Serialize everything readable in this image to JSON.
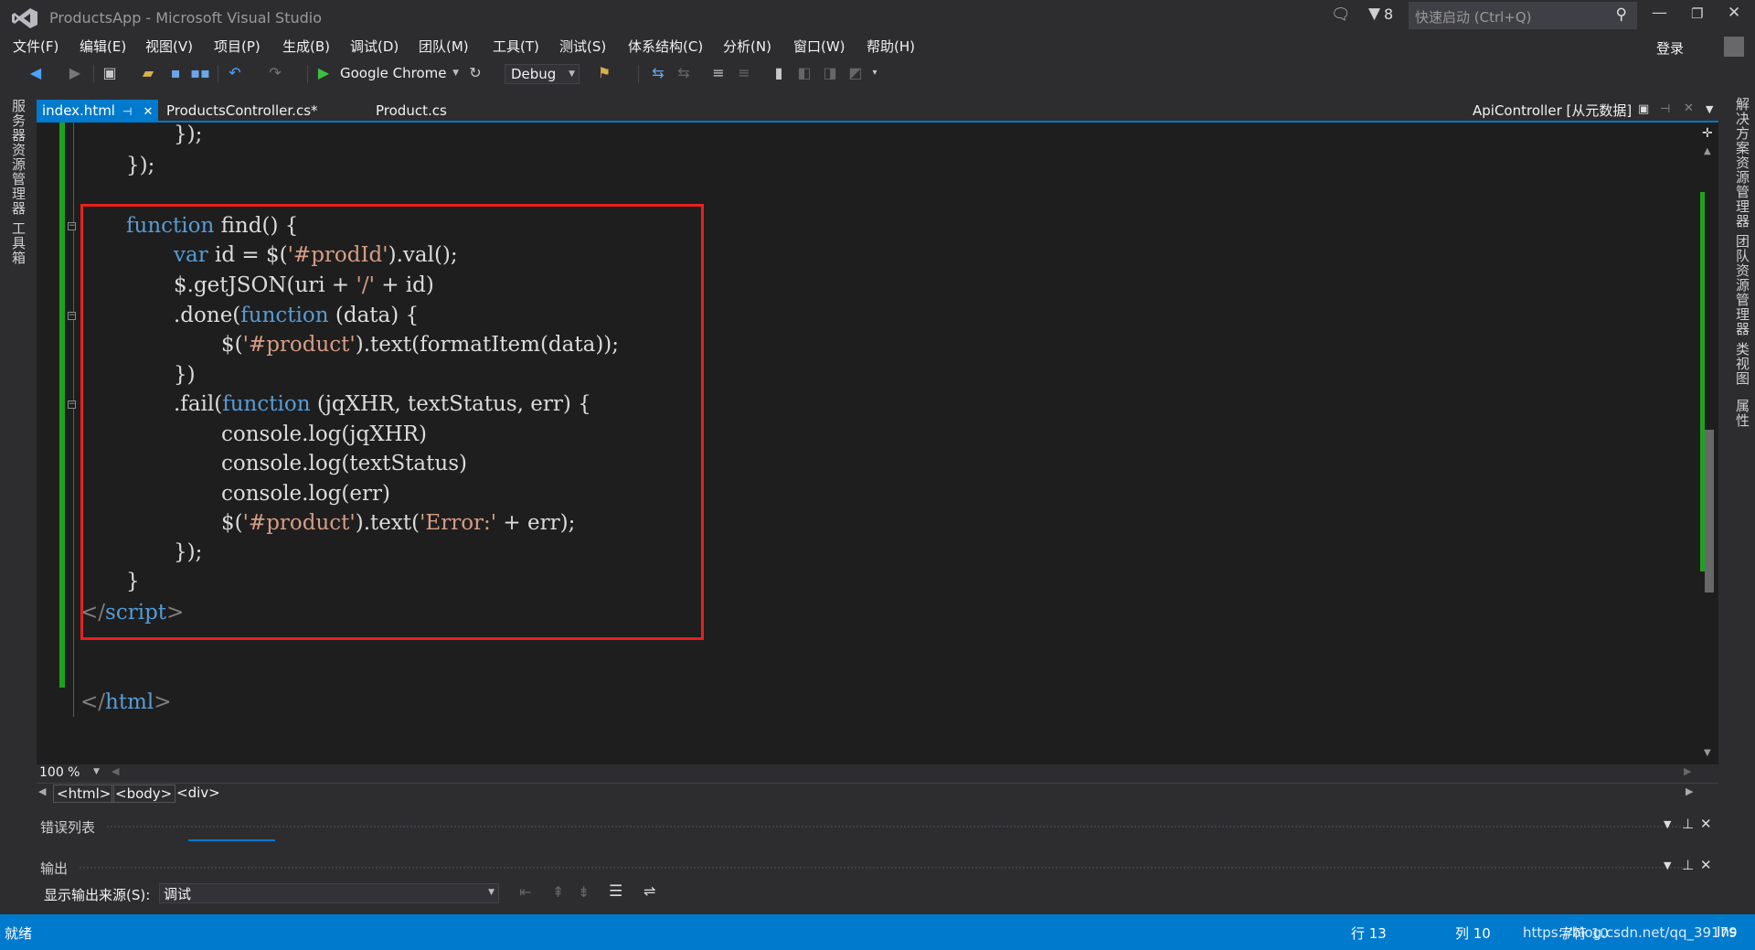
{
  "window": {
    "title": "ProductsApp - Microsoft Visual Studio",
    "filter_count": "8",
    "quick_launch_placeholder": "快速启动 (Ctrl+Q)",
    "login": "登录"
  },
  "menu": [
    "文件(F)",
    "编辑(E)",
    "视图(V)",
    "项目(P)",
    "生成(B)",
    "调试(D)",
    "团队(M)",
    "工具(T)",
    "测试(S)",
    "体系结构(C)",
    "分析(N)",
    "窗口(W)",
    "帮助(H)"
  ],
  "toolbar": {
    "browser": "Google Chrome",
    "config": "Debug"
  },
  "left_rail": [
    "服务器资源管理器",
    "工具箱"
  ],
  "right_rail": [
    "解决方案资源管理器",
    "团队资源管理器",
    "类视图",
    "属性"
  ],
  "tabs": [
    {
      "label": "index.html",
      "active": true
    },
    {
      "label": "ProductsController.cs*",
      "active": false
    },
    {
      "label": "Product.cs",
      "active": false
    }
  ],
  "right_tab": {
    "label": "ApiController [从元数据]"
  },
  "code": {
    "l1": "});",
    "l2": "});",
    "l3_kw": "function",
    "l3_rest": " find() {",
    "l4_kw": "var",
    "l4_a": " id = $(",
    "l4_str": "'#prodId'",
    "l4_b": ").val();",
    "l5_a": "$.getJSON(uri + ",
    "l5_str": "'/'",
    "l5_b": " + id)",
    "l6_a": ".done(",
    "l6_kw": "function",
    "l6_b": " (data) {",
    "l7_a": "$(",
    "l7_str": "'#product'",
    "l7_b": ").text(formatItem(data));",
    "l8": "})",
    "l9_a": ".fail(",
    "l9_kw": "function",
    "l9_b": " (jqXHR, textStatus, err) {",
    "l10": "console.log(jqXHR)",
    "l11": "console.log(textStatus)",
    "l12": "console.log(err)",
    "l13_a": "$(",
    "l13_str": "'#product'",
    "l13_b": ").text(",
    "l13_str2": "'Error:'",
    "l13_c": " + err);",
    "l14": "});",
    "l15": "}",
    "l16_open": "</",
    "l16_tag": "script",
    "l16_close": ">",
    "l17_open": "</",
    "l17_tag": "html",
    "l17_close": ">"
  },
  "zoom": "100 %",
  "breadcrumb": [
    "<html>",
    "<body>",
    "<div>"
  ],
  "panels": {
    "error_list": "错误列表",
    "output": "输出",
    "output_source_label": "显示输出来源(S):",
    "output_source_value": "调试"
  },
  "status": {
    "ready": "就绪",
    "line": "行 13",
    "col": "列 10",
    "char": "字符 10",
    "mode": "Ins",
    "watermark": "https://blog.csdn.net/qq_39179"
  }
}
